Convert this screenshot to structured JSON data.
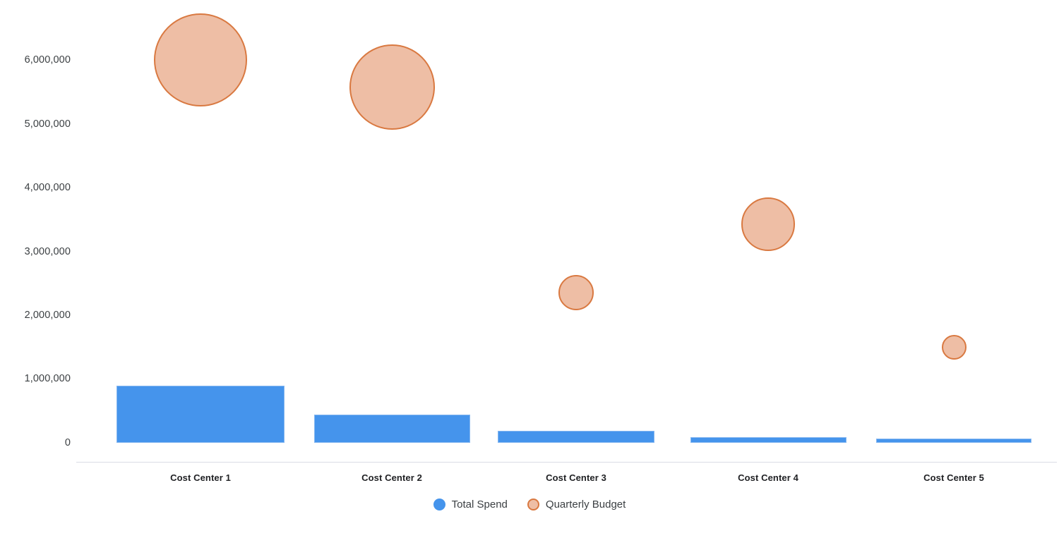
{
  "chart_data": {
    "type": "bar",
    "title": "",
    "subtitle": "",
    "xlabel": "",
    "ylabel": "",
    "categories": [
      "Cost Center 1",
      "Cost Center 2",
      "Cost Center 3",
      "Cost Center 4",
      "Cost Center 5"
    ],
    "ylim": [
      0,
      6500000
    ],
    "y_ticks": [
      0,
      1000000,
      2000000,
      3000000,
      4000000,
      5000000,
      6000000
    ],
    "y_tick_labels": [
      "0",
      "1,000,000",
      "2,000,000",
      "3,000,000",
      "4,000,000",
      "5,000,000",
      "6,000,000"
    ],
    "grid": false,
    "legend_position": "bottom",
    "series": [
      {
        "name": "Total Spend",
        "render": "bar",
        "color": "#4594ec",
        "values": [
          890000,
          440000,
          190000,
          85000,
          70000
        ]
      },
      {
        "name": "Quarterly Budget",
        "render": "bubble",
        "color": "#eebea5",
        "stroke": "#d97941",
        "values": [
          6000000,
          5580000,
          2350000,
          3430000,
          1500000
        ],
        "bubble_sizes": [
          132,
          121,
          50,
          76,
          35
        ]
      }
    ]
  },
  "axis": {
    "baseline_color": "#dadce5",
    "tick_label_color": "#3c4043"
  },
  "legend": {
    "items": [
      {
        "label": "Total Spend",
        "swatch": "filled-circle-blue"
      },
      {
        "label": "Quarterly Budget",
        "swatch": "outlined-circle-peach"
      }
    ]
  }
}
